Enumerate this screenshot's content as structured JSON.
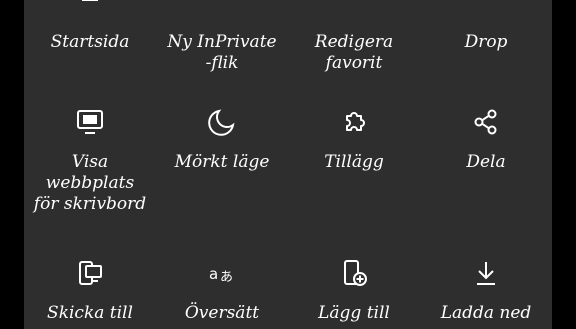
{
  "menu": {
    "row1": [
      {
        "label": "Startsida",
        "icon": "home-icon"
      },
      {
        "label": "Ny InPrivate\n-flik",
        "icon": "inprivate-tab-icon"
      },
      {
        "label": "Redigera\nfavorit",
        "icon": "edit-pen-icon"
      },
      {
        "label": "Drop",
        "icon": "send-icon"
      }
    ],
    "row2": [
      {
        "label": "Visa\nwebbplats\nför skrivbord",
        "icon": "desktop-monitor-icon"
      },
      {
        "label": "Mörkt läge",
        "icon": "moon-icon"
      },
      {
        "label": "Tillägg",
        "icon": "puzzle-extension-icon"
      },
      {
        "label": "Dela",
        "icon": "share-icon"
      }
    ],
    "row3": [
      {
        "label": "Skicka till",
        "icon": "send-to-devices-icon"
      },
      {
        "label": "Översätt",
        "icon": "translate-icon"
      },
      {
        "label": "Lägg till",
        "icon": "add-to-phone-icon"
      },
      {
        "label": "Ladda ned",
        "icon": "download-icon"
      }
    ]
  }
}
